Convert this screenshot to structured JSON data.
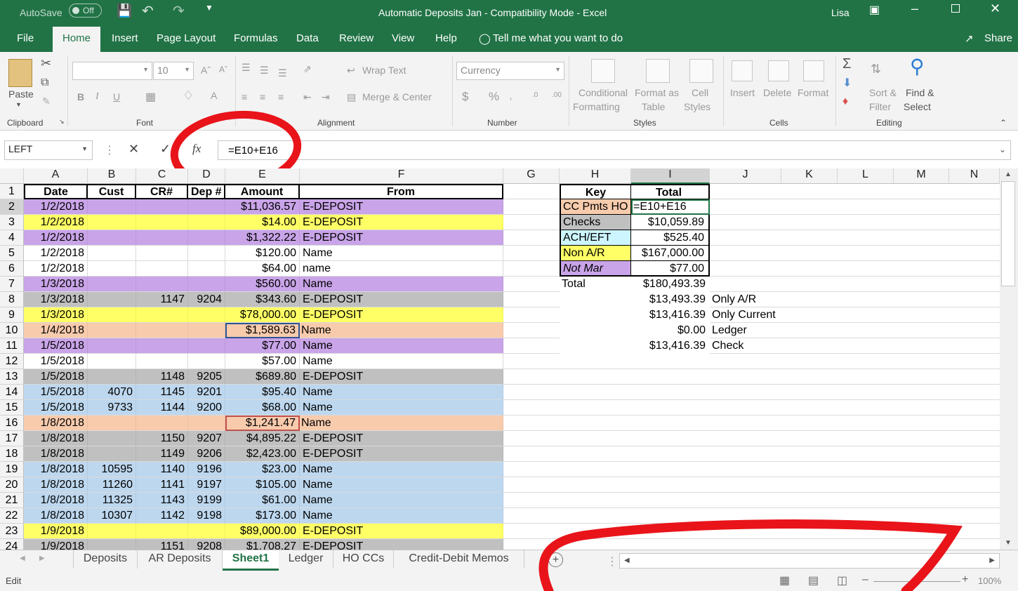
{
  "title_bar": {
    "autosave": "AutoSave",
    "autosave_state": "Off",
    "document": "Automatic Deposits Jan  -  Compatibility Mode  -  Excel",
    "user": "Lisa"
  },
  "tabs": [
    "File",
    "Home",
    "Insert",
    "Page Layout",
    "Formulas",
    "Data",
    "Review",
    "View",
    "Help"
  ],
  "tell_me": "Tell me what you want to do",
  "share": "Share",
  "ribbon": {
    "paste": "Paste",
    "font_size": "10",
    "wrap_text": "Wrap Text",
    "merge_center": "Merge & Center",
    "number_format": "Currency",
    "conditional_formatting": [
      "Conditional",
      "Formatting"
    ],
    "format_as_table": [
      "Format as",
      "Table"
    ],
    "cell_styles": [
      "Cell",
      "Styles"
    ],
    "insert": "Insert",
    "delete": "Delete",
    "format": "Format",
    "sort_filter": [
      "Sort &",
      "Filter"
    ],
    "find_select": [
      "Find &",
      "Select"
    ],
    "groups": [
      "Clipboard",
      "Font",
      "Alignment",
      "Number",
      "Styles",
      "Cells",
      "Editing"
    ]
  },
  "name_box": "LEFT",
  "formula": "=E10+E16",
  "columns": [
    "A",
    "B",
    "C",
    "D",
    "E",
    "F",
    "G",
    "H",
    "I",
    "J",
    "K",
    "L",
    "M",
    "N"
  ],
  "rows": [
    {
      "n": "1",
      "A": "Date",
      "B": "Cust",
      "C": "CR#",
      "D": "Dep #",
      "E": "Amount",
      "F": "From",
      "fill": "#ffffff"
    },
    {
      "n": "2",
      "A": "1/2/2018",
      "B": "",
      "C": "",
      "D": "",
      "E": "$11,036.57",
      "F": "E-DEPOSIT",
      "fill": "#c9a4e8"
    },
    {
      "n": "3",
      "A": "1/2/2018",
      "B": "",
      "C": "",
      "D": "",
      "E": "$14.00",
      "F": "E-DEPOSIT",
      "fill": "#ffff66"
    },
    {
      "n": "4",
      "A": "1/2/2018",
      "B": "",
      "C": "",
      "D": "",
      "E": "$1,322.22",
      "F": "E-DEPOSIT",
      "fill": "#c9a4e8"
    },
    {
      "n": "5",
      "A": "1/2/2018",
      "B": "",
      "C": "",
      "D": "",
      "E": "$120.00",
      "F": "Name",
      "fill": "#ffffff"
    },
    {
      "n": "6",
      "A": "1/2/2018",
      "B": "",
      "C": "",
      "D": "",
      "E": "$64.00",
      "F": "name",
      "fill": "#ffffff"
    },
    {
      "n": "7",
      "A": "1/3/2018",
      "B": "",
      "C": "",
      "D": "",
      "E": "$560.00",
      "F": "Name",
      "fill": "#c9a4e8"
    },
    {
      "n": "8",
      "A": "1/3/2018",
      "B": "",
      "C": "1147",
      "D": "9204",
      "E": "$343.60",
      "F": "E-DEPOSIT",
      "fill": "#c0c0c0"
    },
    {
      "n": "9",
      "A": "1/3/2018",
      "B": "",
      "C": "",
      "D": "",
      "E": "$78,000.00",
      "F": "E-DEPOSIT",
      "fill": "#ffff66"
    },
    {
      "n": "10",
      "A": "1/4/2018",
      "B": "",
      "C": "",
      "D": "",
      "E": "$1,589.63",
      "F": "Name",
      "fill": "#f8cbad"
    },
    {
      "n": "11",
      "A": "1/5/2018",
      "B": "",
      "C": "",
      "D": "",
      "E": "$77.00",
      "F": "Name",
      "fill": "#c9a4e8"
    },
    {
      "n": "12",
      "A": "1/5/2018",
      "B": "",
      "C": "",
      "D": "",
      "E": "$57.00",
      "F": "Name",
      "fill": "#ffffff"
    },
    {
      "n": "13",
      "A": "1/5/2018",
      "B": "",
      "C": "1148",
      "D": "9205",
      "E": "$689.80",
      "F": "E-DEPOSIT",
      "fill": "#c0c0c0"
    },
    {
      "n": "14",
      "A": "1/5/2018",
      "B": "4070",
      "C": "1145",
      "D": "9201",
      "E": "$95.40",
      "F": "Name",
      "fill": "#bdd7ee"
    },
    {
      "n": "15",
      "A": "1/5/2018",
      "B": "9733",
      "C": "1144",
      "D": "9200",
      "E": "$68.00",
      "F": "Name",
      "fill": "#bdd7ee"
    },
    {
      "n": "16",
      "A": "1/8/2018",
      "B": "",
      "C": "",
      "D": "",
      "E": "$1,241.47",
      "F": "Name",
      "fill": "#f8cbad"
    },
    {
      "n": "17",
      "A": "1/8/2018",
      "B": "",
      "C": "1150",
      "D": "9207",
      "E": "$4,895.22",
      "F": "E-DEPOSIT",
      "fill": "#c0c0c0"
    },
    {
      "n": "18",
      "A": "1/8/2018",
      "B": "",
      "C": "1149",
      "D": "9206",
      "E": "$2,423.00",
      "F": "E-DEPOSIT",
      "fill": "#c0c0c0"
    },
    {
      "n": "19",
      "A": "1/8/2018",
      "B": "10595",
      "C": "1140",
      "D": "9196",
      "E": "$23.00",
      "F": "Name",
      "fill": "#bdd7ee"
    },
    {
      "n": "20",
      "A": "1/8/2018",
      "B": "11260",
      "C": "1141",
      "D": "9197",
      "E": "$105.00",
      "F": "Name",
      "fill": "#bdd7ee"
    },
    {
      "n": "21",
      "A": "1/8/2018",
      "B": "11325",
      "C": "1143",
      "D": "9199",
      "E": "$61.00",
      "F": "Name",
      "fill": "#bdd7ee"
    },
    {
      "n": "22",
      "A": "1/8/2018",
      "B": "10307",
      "C": "1142",
      "D": "9198",
      "E": "$173.00",
      "F": "Name",
      "fill": "#bdd7ee"
    },
    {
      "n": "23",
      "A": "1/9/2018",
      "B": "",
      "C": "",
      "D": "",
      "E": "$89,000.00",
      "F": "E-DEPOSIT",
      "fill": "#ffff66"
    },
    {
      "n": "24",
      "A": "1/9/2018",
      "B": "",
      "C": "1151",
      "D": "9208",
      "E": "$1,708.27",
      "F": "E-DEPOSIT",
      "fill": "#c0c0c0"
    }
  ],
  "key_table": [
    {
      "H": "Key",
      "I": "Total",
      "J": "",
      "hfill": "#ffffff"
    },
    {
      "H": "CC Pmts HO",
      "I": "=E10+E16",
      "J": "",
      "hfill": "#f8cbad"
    },
    {
      "H": "Checks",
      "I": "$10,059.89",
      "J": "",
      "hfill": "#c0c0c0"
    },
    {
      "H": "ACH/EFT",
      "I": "$525.40",
      "J": "",
      "hfill": "#ccf5ff"
    },
    {
      "H": "Non A/R",
      "I": "$167,000.00",
      "J": "",
      "hfill": "#ffff66"
    },
    {
      "H": "Not Mar",
      "I": "$77.00",
      "J": "",
      "hfill": "#c9a4e8"
    },
    {
      "H": "Total",
      "I": "$180,493.39",
      "J": "",
      "hfill": "#ffffff"
    },
    {
      "H": "",
      "I": "$13,493.39",
      "J": "Only A/R",
      "hfill": "#ffffff"
    },
    {
      "H": "",
      "I": "$13,416.39",
      "J": "Only Current",
      "hfill": "#ffffff"
    },
    {
      "H": "",
      "I": "$0.00",
      "J": "Ledger",
      "hfill": "#ffffff"
    },
    {
      "H": "",
      "I": "$13,416.39",
      "J": "Check",
      "hfill": "#ffffff"
    }
  ],
  "sheet_tabs": [
    "Deposits",
    "AR Deposits",
    "Sheet1",
    "Ledger",
    "HO CCs",
    "Credit-Debit Memos"
  ],
  "active_sheet": "Sheet1",
  "status": "Edit",
  "zoom": "100%"
}
